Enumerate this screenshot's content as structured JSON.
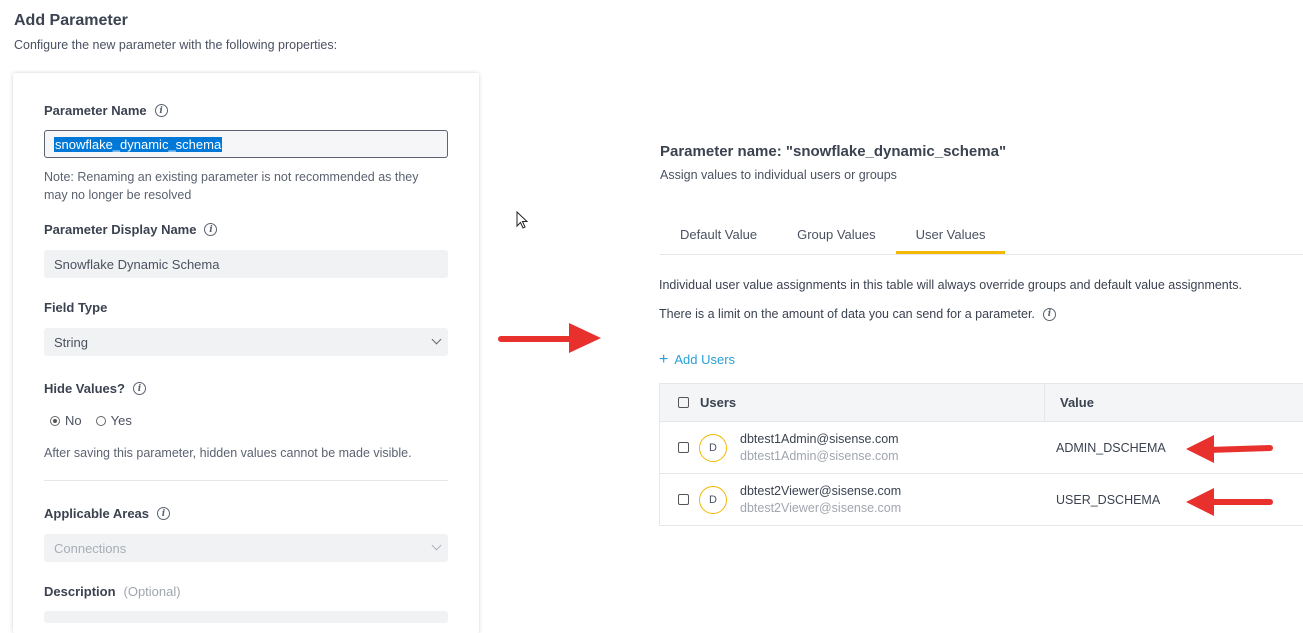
{
  "page": {
    "title": "Add Parameter",
    "subtitle": "Configure the new parameter with the following properties:"
  },
  "form": {
    "param_name_label": "Parameter Name",
    "param_name_value": "snowflake_dynamic_schema",
    "rename_note": "Note: Renaming an existing parameter is not recommended as they may no longer be resolved",
    "display_name_label": "Parameter Display Name",
    "display_name_value": "Snowflake Dynamic Schema",
    "field_type_label": "Field Type",
    "field_type_value": "String",
    "hide_values_label": "Hide Values?",
    "hide_no": "No",
    "hide_yes": "Yes",
    "hide_selected": "No",
    "hidden_note": "After saving this parameter, hidden values cannot be made visible.",
    "areas_label": "Applicable Areas",
    "areas_value": "Connections",
    "description_label": "Description",
    "description_optional": "(Optional)"
  },
  "detail": {
    "title": "Parameter name: \"snowflake_dynamic_schema\"",
    "subtitle": "Assign values to individual users or groups",
    "tabs": [
      {
        "label": "Default Value",
        "active": false
      },
      {
        "label": "Group Values",
        "active": false
      },
      {
        "label": "User Values",
        "active": true
      }
    ],
    "override_text": "Individual user value assignments in this table will always override groups and default value assignments.",
    "limit_text": "There is a limit on the amount of data you can send for a parameter.",
    "add_users_label": "Add Users",
    "table": {
      "col_users": "Users",
      "col_value": "Value",
      "rows": [
        {
          "avatar": "D",
          "name": "dbtest1Admin@sisense.com",
          "email": "dbtest1Admin@sisense.com",
          "value": "ADMIN_DSCHEMA"
        },
        {
          "avatar": "D",
          "name": "dbtest2Viewer@sisense.com",
          "email": "dbtest2Viewer@sisense.com",
          "value": "USER_DSCHEMA"
        }
      ]
    }
  },
  "colors": {
    "accent_tab": "#f2b900",
    "link": "#2a9fd6",
    "annotation_arrow": "#e8312c",
    "selection": "#0078d7"
  }
}
